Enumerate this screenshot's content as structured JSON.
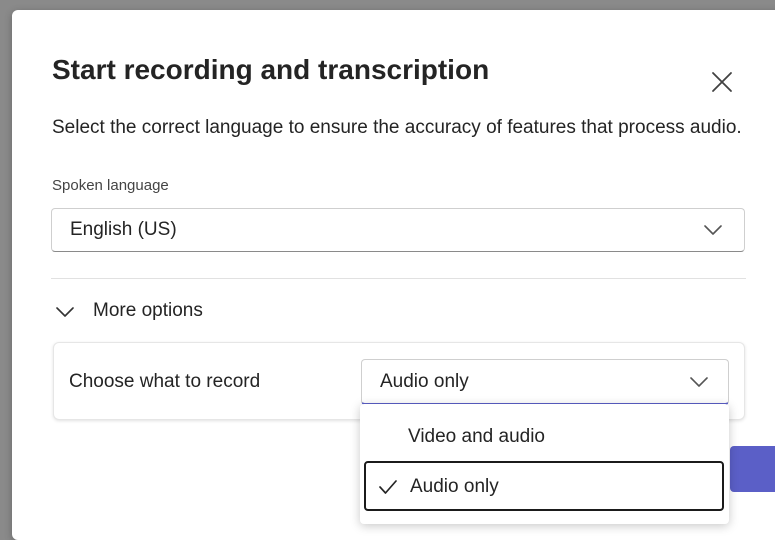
{
  "dialog": {
    "title": "Start recording and transcription",
    "close_icon": "close-icon",
    "description": "Select the correct language to ensure the accuracy of features that process audio.",
    "spoken_language_label": "Spoken language",
    "spoken_language_value": "English (US)",
    "more_options_label": "More options",
    "record": {
      "label": "Choose what to record",
      "selected_value": "Audio only",
      "options": [
        {
          "label": "Video and audio",
          "selected": false
        },
        {
          "label": "Audio only",
          "selected": true
        }
      ]
    },
    "colors": {
      "accent": "#5b5fc7",
      "text": "#242424",
      "backdrop": "#8a8a8a"
    }
  }
}
